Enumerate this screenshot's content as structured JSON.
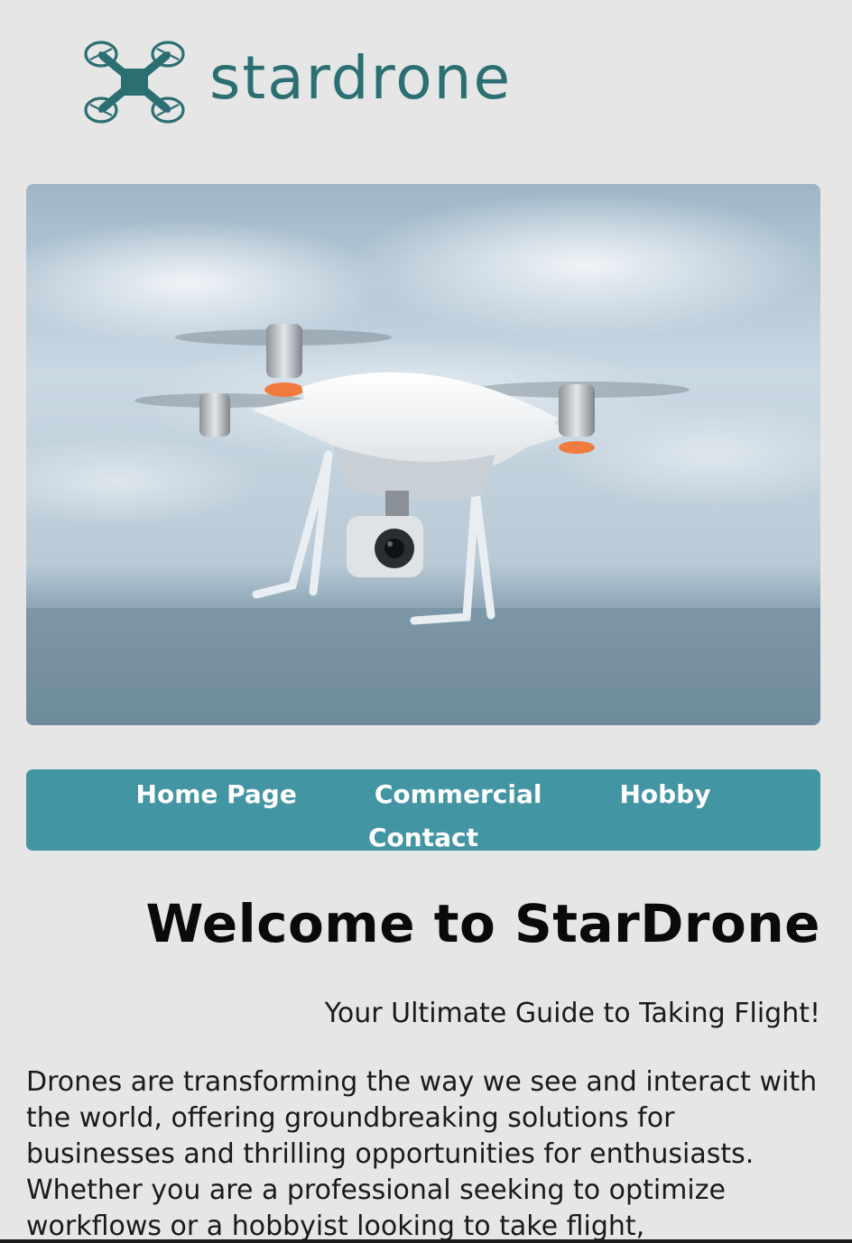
{
  "brand": {
    "name": "stardrone",
    "logo_icon": "quadcopter-icon",
    "color": "#2b6f73"
  },
  "hero": {
    "icon": "drone-photo"
  },
  "nav": {
    "background": "#4495a3",
    "items": [
      {
        "label": "Home Page"
      },
      {
        "label": "Commercial"
      },
      {
        "label": "Hobby"
      },
      {
        "label": "Contact"
      }
    ]
  },
  "main": {
    "title": "Welcome to StarDrone",
    "subtitle": "Your Ultimate Guide to Taking Flight!",
    "body": "Drones are transforming the way we see and interact with the world, offering groundbreaking solutions for businesses and thrilling opportunities for enthusiasts. Whether you are a professional seeking to optimize workflows or a hobbyist looking to take flight,"
  }
}
